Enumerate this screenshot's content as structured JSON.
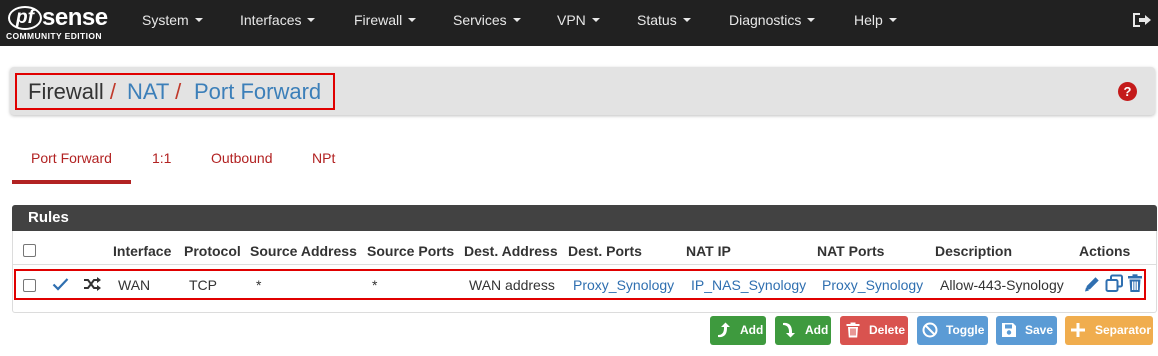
{
  "brand": {
    "logo_pf": "pf",
    "logo_sense": "sense",
    "logo_sub": "COMMUNITY EDITION"
  },
  "nav": [
    {
      "label": "System"
    },
    {
      "label": "Interfaces"
    },
    {
      "label": "Firewall"
    },
    {
      "label": "Services"
    },
    {
      "label": "VPN"
    },
    {
      "label": "Status"
    },
    {
      "label": "Diagnostics"
    },
    {
      "label": "Help"
    }
  ],
  "breadcrumb": {
    "root": "Firewall",
    "sep": "/",
    "level2": "NAT",
    "level3": "Port Forward",
    "help_glyph": "?"
  },
  "tabs": [
    {
      "label": "Port Forward",
      "active": true
    },
    {
      "label": "1:1"
    },
    {
      "label": "Outbound"
    },
    {
      "label": "NPt"
    }
  ],
  "rules": {
    "title": "Rules",
    "columns": [
      "Interface",
      "Protocol",
      "Source Address",
      "Source Ports",
      "Dest. Address",
      "Dest. Ports",
      "NAT IP",
      "NAT Ports",
      "Description",
      "Actions"
    ],
    "rows": [
      {
        "interface": "WAN",
        "protocol": "TCP",
        "source_address": "*",
        "source_ports": "*",
        "dest_address": "WAN address",
        "dest_ports": "Proxy_Synology",
        "nat_ip": "IP_NAS_Synology",
        "nat_ports": "Proxy_Synology",
        "description": "Allow-443-Synology",
        "enabled": true,
        "status_icon": "check-icon",
        "type_icon": "shuffle-icon",
        "actions": [
          "pencil-icon",
          "copy-icon",
          "trash-icon"
        ]
      }
    ]
  },
  "buttons": {
    "add_top": "Add",
    "add_bottom": "Add",
    "delete": "Delete",
    "toggle": "Toggle",
    "save": "Save",
    "separator": "Separator"
  },
  "colors": {
    "navbar": "#212121",
    "accent_red": "#b22222",
    "link_blue": "#2f6fb0",
    "green": "#3e9a3e",
    "red": "#d9534f",
    "blue": "#5b9bd5",
    "orange": "#f0ad4e"
  }
}
